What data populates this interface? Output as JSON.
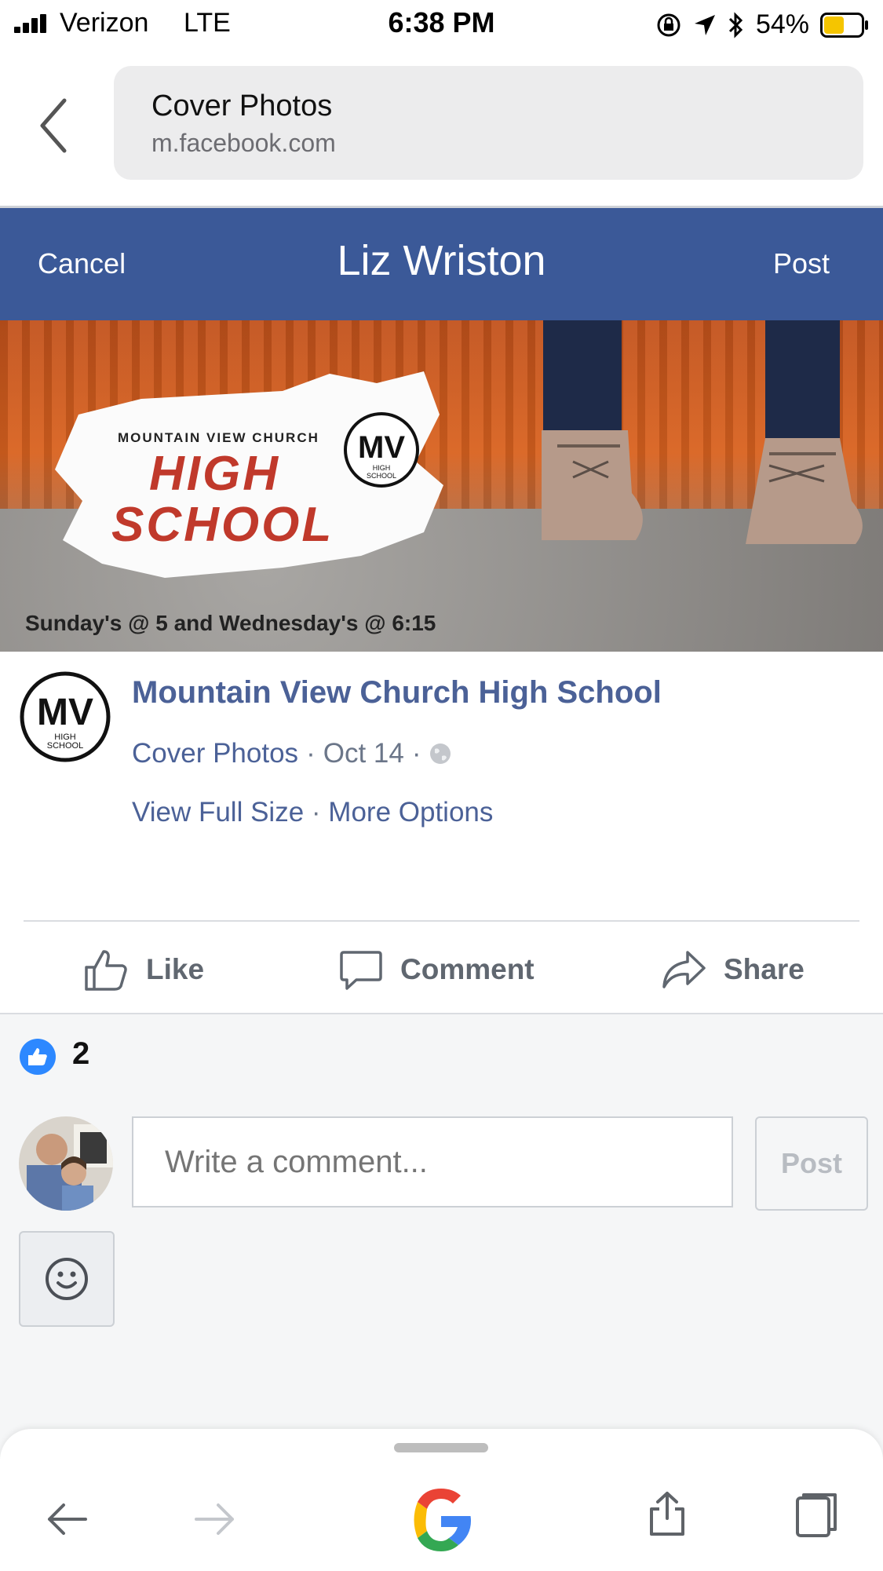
{
  "status_bar": {
    "carrier": "Verizon",
    "network": "LTE",
    "time": "6:38 PM",
    "battery_pct": "54%",
    "battery_level": 0.54
  },
  "browser": {
    "tab_title": "Cover Photos",
    "domain": "m.facebook.com"
  },
  "fb_nav": {
    "cancel_label": "Cancel",
    "title": "Liz Wriston",
    "post_label": "Post",
    "bg_color": "#3b5998"
  },
  "cover": {
    "church_text": "MOUNTAIN VIEW CHURCH",
    "high": "HIGH",
    "school": "SCHOOL",
    "logo_initials": "MV",
    "logo_sub_1": "HIGH",
    "logo_sub_2": "SCHOOL",
    "caption": "Sunday's @ 5 and Wednesday's @ 6:15"
  },
  "post": {
    "page_name": "Mountain View Church High School",
    "album": "Cover Photos",
    "sep": "·",
    "date": "Oct 14",
    "view_full_size": "View Full Size",
    "more_options": "More Options",
    "avatar_initials": "MV",
    "avatar_sub_1": "HIGH",
    "avatar_sub_2": "SCHOOL"
  },
  "actions": {
    "like": "Like",
    "comment": "Comment",
    "share": "Share"
  },
  "reactions": {
    "count": "2"
  },
  "comment_box": {
    "placeholder": "Write a comment...",
    "post_label": "Post"
  }
}
